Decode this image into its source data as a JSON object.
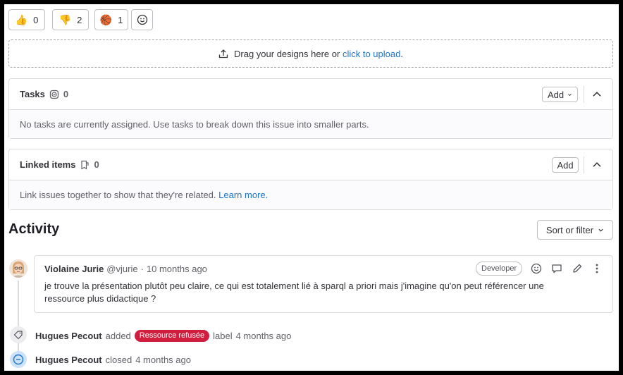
{
  "reactions": [
    {
      "emoji": "👍",
      "count": "0",
      "icon": "thumbs-up-icon"
    },
    {
      "emoji": "👎",
      "count": "2",
      "icon": "thumbs-down-icon"
    },
    {
      "emoji": "🏀",
      "count": "1",
      "icon": "basketball-icon"
    }
  ],
  "add_reaction_icon": "smiley-icon",
  "design_upload": {
    "text": "Drag your designs here or",
    "link": "click to upload",
    "suffix": "."
  },
  "tasks": {
    "title": "Tasks",
    "count": "0",
    "add_label": "Add",
    "empty_text": "No tasks are currently assigned. Use tasks to break down this issue into smaller parts."
  },
  "linked_items": {
    "title": "Linked items",
    "count": "0",
    "add_label": "Add",
    "empty_text": "Link issues together to show that they're related.",
    "learn_more": "Learn more."
  },
  "activity": {
    "heading": "Activity",
    "sort_label": "Sort or filter"
  },
  "comment": {
    "author": "Violaine Jurie",
    "handle": "@vjurie",
    "separator": "·",
    "time": "10 months ago",
    "role_badge": "Developer",
    "text": "je trouve la présentation plutôt peu claire, ce qui est totalement lié à sparql a priori mais j'imagine qu'on peut référencer une ressource plus didactique ?"
  },
  "events": [
    {
      "author": "Hugues Pecout",
      "action": "added",
      "label": "Ressource refusée",
      "suffix": "label",
      "time": "4 months ago",
      "icon": "label-icon"
    },
    {
      "author": "Hugues Pecout",
      "action": "closed",
      "time": "4 months ago",
      "icon": "issue-closed-icon"
    }
  ],
  "colors": {
    "link": "#1f75cb",
    "label_red": "#d11d3e",
    "closed_blue": "#1f75cb"
  }
}
